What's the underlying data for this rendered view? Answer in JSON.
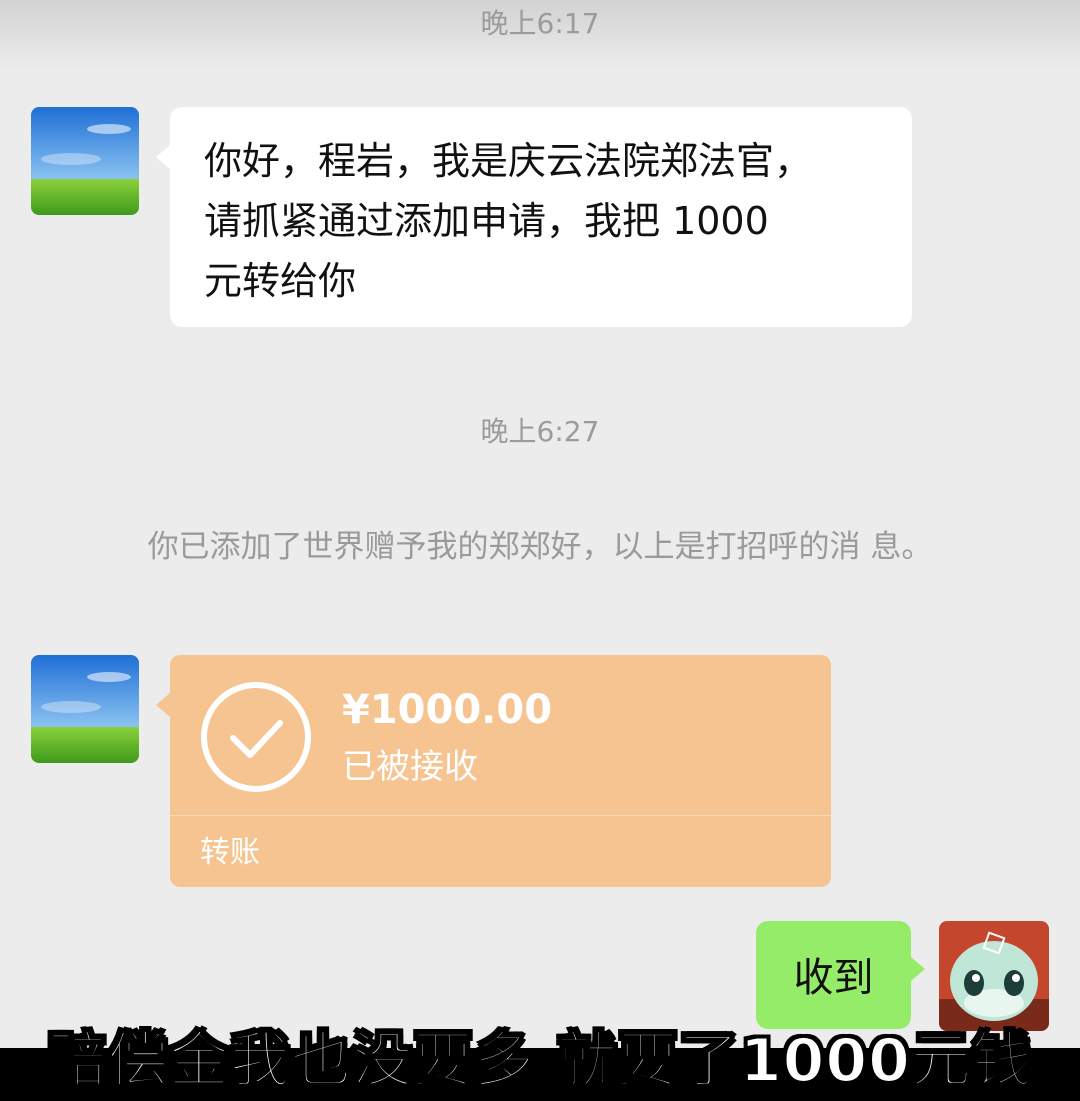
{
  "chat": {
    "time_1": "晚上6:17",
    "message_1": "你好，程岩，我是庆云法院郑法官，\n请抓紧通过添加申请，我把 1000\n元转给你",
    "time_2": "晚上6:27",
    "system_notice": "你已添加了世界赠予我的郑郑好，以上是打招呼的消\n息。",
    "transfer": {
      "amount": "¥1000.00",
      "status": "已被接收",
      "label": "转账"
    },
    "reply": "收到"
  },
  "caption": "赔偿金我也没要多 就要了1000元钱",
  "colors": {
    "chat_background": "#ececec",
    "transfer_card": "#f6c490",
    "my_bubble": "#95ec69"
  },
  "icons": [
    "landscape-avatar",
    "checkmark-circle-icon",
    "cartoon-avatar"
  ]
}
